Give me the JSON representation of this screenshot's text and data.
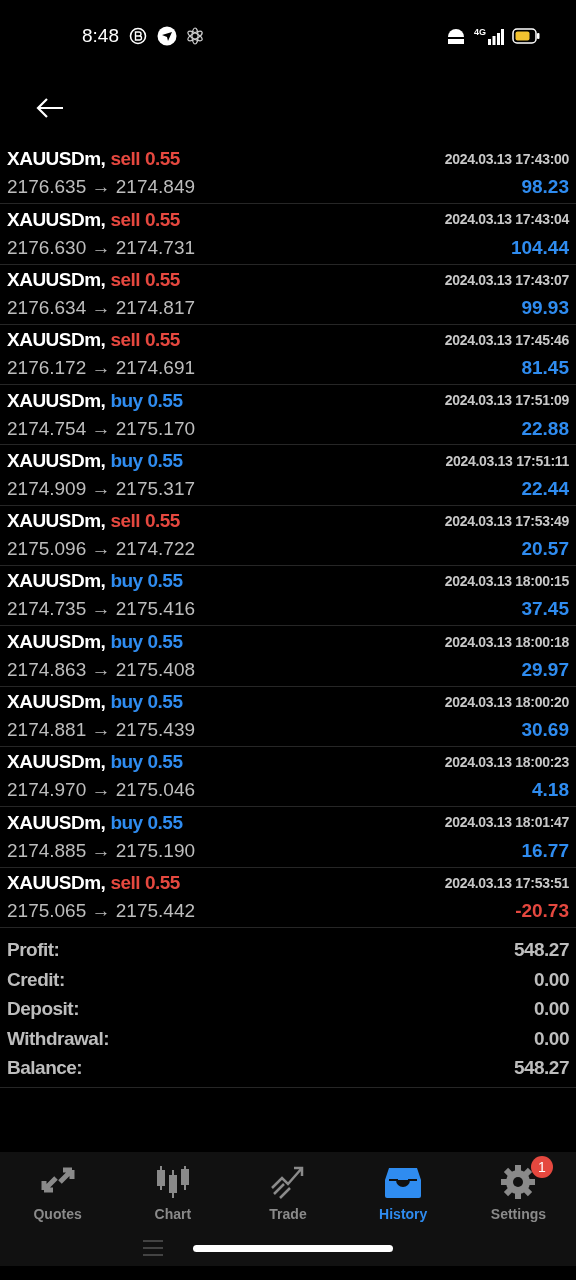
{
  "status_bar": {
    "time": "8:48",
    "network": "4G"
  },
  "deals": [
    {
      "symbol": "XAUUSDm,",
      "order": "sell 0.55",
      "kind": "sell",
      "prices": "2176.635 → 2174.849",
      "time": "2024.03.13 17:43:00",
      "profit": "98.23",
      "loss": false
    },
    {
      "symbol": "XAUUSDm,",
      "order": "sell 0.55",
      "kind": "sell",
      "prices": "2176.630 → 2174.731",
      "time": "2024.03.13 17:43:04",
      "profit": "104.44",
      "loss": false
    },
    {
      "symbol": "XAUUSDm,",
      "order": "sell 0.55",
      "kind": "sell",
      "prices": "2176.634 → 2174.817",
      "time": "2024.03.13 17:43:07",
      "profit": "99.93",
      "loss": false
    },
    {
      "symbol": "XAUUSDm,",
      "order": "sell 0.55",
      "kind": "sell",
      "prices": "2176.172 → 2174.691",
      "time": "2024.03.13 17:45:46",
      "profit": "81.45",
      "loss": false
    },
    {
      "symbol": "XAUUSDm,",
      "order": "buy 0.55",
      "kind": "buy",
      "prices": "2174.754 → 2175.170",
      "time": "2024.03.13 17:51:09",
      "profit": "22.88",
      "loss": false
    },
    {
      "symbol": "XAUUSDm,",
      "order": "buy 0.55",
      "kind": "buy",
      "prices": "2174.909 → 2175.317",
      "time": "2024.03.13 17:51:11",
      "profit": "22.44",
      "loss": false
    },
    {
      "symbol": "XAUUSDm,",
      "order": "sell 0.55",
      "kind": "sell",
      "prices": "2175.096 → 2174.722",
      "time": "2024.03.13 17:53:49",
      "profit": "20.57",
      "loss": false
    },
    {
      "symbol": "XAUUSDm,",
      "order": "buy 0.55",
      "kind": "buy",
      "prices": "2174.735 → 2175.416",
      "time": "2024.03.13 18:00:15",
      "profit": "37.45",
      "loss": false
    },
    {
      "symbol": "XAUUSDm,",
      "order": "buy 0.55",
      "kind": "buy",
      "prices": "2174.863 → 2175.408",
      "time": "2024.03.13 18:00:18",
      "profit": "29.97",
      "loss": false
    },
    {
      "symbol": "XAUUSDm,",
      "order": "buy 0.55",
      "kind": "buy",
      "prices": "2174.881 → 2175.439",
      "time": "2024.03.13 18:00:20",
      "profit": "30.69",
      "loss": false
    },
    {
      "symbol": "XAUUSDm,",
      "order": "buy 0.55",
      "kind": "buy",
      "prices": "2174.970 → 2175.046",
      "time": "2024.03.13 18:00:23",
      "profit": "4.18",
      "loss": false
    },
    {
      "symbol": "XAUUSDm,",
      "order": "buy 0.55",
      "kind": "buy",
      "prices": "2174.885 → 2175.190",
      "time": "2024.03.13 18:01:47",
      "profit": "16.77",
      "loss": false
    },
    {
      "symbol": "XAUUSDm,",
      "order": "sell 0.55",
      "kind": "sell",
      "prices": "2175.065 → 2175.442",
      "time": "2024.03.13 17:53:51",
      "profit": "-20.73",
      "loss": true
    }
  ],
  "summary": [
    {
      "label": "Profit:",
      "value": "548.27"
    },
    {
      "label": "Credit:",
      "value": "0.00"
    },
    {
      "label": "Deposit:",
      "value": "0.00"
    },
    {
      "label": "Withdrawal:",
      "value": "0.00"
    },
    {
      "label": "Balance:",
      "value": "548.27"
    }
  ],
  "tabs": [
    {
      "label": "Quotes",
      "kind": "quotes",
      "selected": false
    },
    {
      "label": "Chart",
      "kind": "chart",
      "selected": false
    },
    {
      "label": "Trade",
      "kind": "trade",
      "selected": false
    },
    {
      "label": "History",
      "kind": "history",
      "selected": true
    },
    {
      "label": "Settings",
      "kind": "settings",
      "selected": false,
      "badge": "1"
    }
  ]
}
